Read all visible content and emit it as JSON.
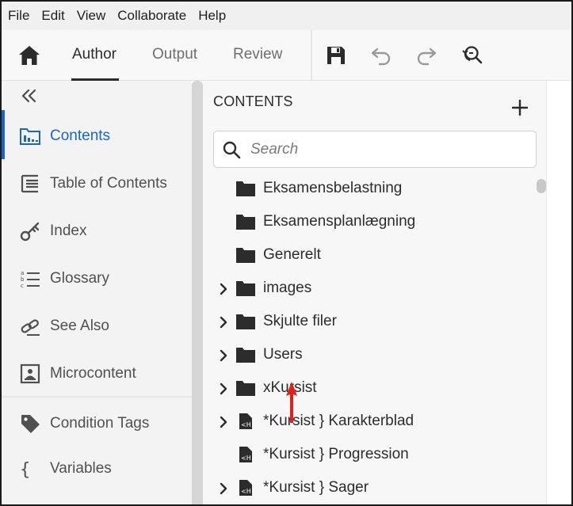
{
  "menu": [
    "File",
    "Edit",
    "View",
    "Collaborate",
    "Help"
  ],
  "toolbar": {
    "tabs": [
      {
        "label": "Author",
        "active": true
      },
      {
        "label": "Output",
        "active": false
      },
      {
        "label": "Review",
        "active": false
      }
    ],
    "icons": [
      "home-icon",
      "save-icon",
      "undo-icon",
      "redo-icon",
      "find-replace-icon"
    ]
  },
  "sidebar": {
    "items": [
      {
        "label": "Contents",
        "icon": "contents-icon",
        "active": true
      },
      {
        "label": "Table of Contents",
        "icon": "toc-icon",
        "active": false
      },
      {
        "label": "Index",
        "icon": "key-icon",
        "active": false
      },
      {
        "label": "Glossary",
        "icon": "glossary-icon",
        "active": false
      },
      {
        "label": "See Also",
        "icon": "link-icon",
        "active": false
      },
      {
        "label": "Microcontent",
        "icon": "microcontent-icon",
        "active": false
      },
      {
        "label": "Condition Tags",
        "icon": "tag-icon",
        "active": false
      },
      {
        "label": "Variables",
        "icon": "braces-icon",
        "active": false
      }
    ]
  },
  "contents": {
    "title": "CONTENTS",
    "search_placeholder": "Search",
    "items": [
      {
        "label": "Eksamensbelastning",
        "type": "folder",
        "expandable": false
      },
      {
        "label": "Eksamensplanlægning",
        "type": "folder",
        "expandable": false
      },
      {
        "label": "Generelt",
        "type": "folder",
        "expandable": false
      },
      {
        "label": "images",
        "type": "folder",
        "expandable": true
      },
      {
        "label": "Skjulte filer",
        "type": "folder",
        "expandable": true
      },
      {
        "label": "Users",
        "type": "folder",
        "expandable": true
      },
      {
        "label": "xKursist",
        "type": "folder",
        "expandable": true
      },
      {
        "label": "*Kursist } Karakterblad",
        "type": "map",
        "expandable": true
      },
      {
        "label": "*Kursist } Progression",
        "type": "map",
        "expandable": false
      },
      {
        "label": "*Kursist } Sager",
        "type": "map",
        "expandable": true
      }
    ]
  },
  "colors": {
    "accent": "#1a66c8",
    "annotation_arrow": "#e0201b"
  }
}
